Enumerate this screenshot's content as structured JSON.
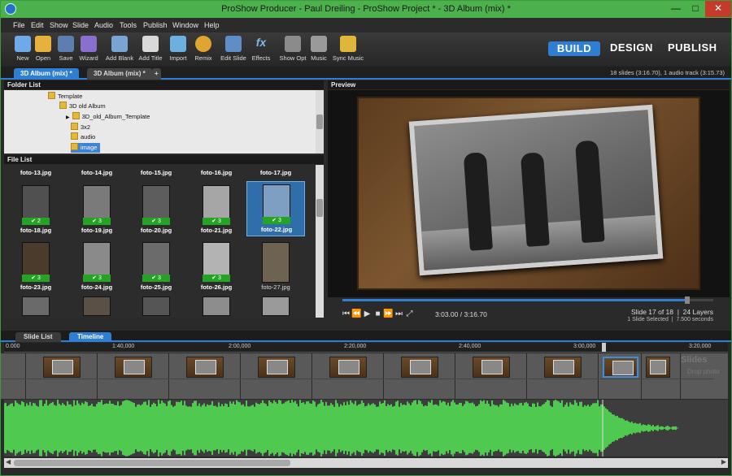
{
  "app": {
    "title": "ProShow Producer - Paul Dreiling - ProShow Project * - 3D Album (mix) *"
  },
  "menu": [
    "File",
    "Edit",
    "Show",
    "Slide",
    "Audio",
    "Tools",
    "Publish",
    "Window",
    "Help"
  ],
  "toolbar": {
    "buttons": [
      "New",
      "Open",
      "Save",
      "Wizard",
      "Add Blank",
      "Add Title",
      "Import",
      "Remix",
      "Edit Slide",
      "Effects",
      "Show Opt",
      "Music",
      "Sync Music"
    ]
  },
  "modes": {
    "build": "BUILD",
    "design": "DESIGN",
    "publish": "PUBLISH"
  },
  "project_tabs": {
    "active": "3D Album (mix) *",
    "other": "3D Album (mix) *",
    "add": "+"
  },
  "project_info": "18 slides (3:16.70), 1 audio track (3:15.73)",
  "folder_list": {
    "header": "Folder List",
    "items": [
      "Template",
      "3D old Album",
      "3D_old_Album_Template",
      "3x2",
      "audio",
      "image"
    ]
  },
  "file_list": {
    "header": "File List",
    "top_captions": [
      "foto-13.jpg",
      "foto-14.jpg",
      "foto-15.jpg",
      "foto-16.jpg",
      "foto-17.jpg"
    ],
    "rows": [
      [
        {
          "name": "foto-18.jpg",
          "count": "2"
        },
        {
          "name": "foto-19.jpg",
          "count": "3"
        },
        {
          "name": "foto-20.jpg",
          "count": "3"
        },
        {
          "name": "foto-21.jpg",
          "count": "3"
        },
        {
          "name": "foto-22.jpg",
          "count": "3"
        }
      ],
      [
        {
          "name": "foto-23.jpg",
          "count": "3"
        },
        {
          "name": "foto-24.jpg",
          "count": "3"
        },
        {
          "name": "foto-25.jpg",
          "count": "3"
        },
        {
          "name": "foto-26.jpg",
          "count": "3"
        },
        {
          "name": "foto-27.jpg",
          "count": ""
        }
      ]
    ]
  },
  "preview": {
    "header": "Preview",
    "timecode": "3:03.00 / 3:16.70",
    "slide_info": "Slide 17 of 18",
    "layers": "24 Layers",
    "selection_info": "1 Slide Selected",
    "seconds": "7.500 seconds",
    "position": 0.93
  },
  "bottom_tabs": {
    "slide_list": "Slide List",
    "timeline": "Timeline"
  },
  "timeline": {
    "ruler": [
      "0.000",
      "1:40,000",
      "2:00,000",
      "2:20,000",
      "2:40,000",
      "3:00,000",
      "3:20,000"
    ],
    "drop_title": "Slides",
    "drop_hint": "Drop photo"
  },
  "colors": {
    "accent": "#2e7fd3",
    "title_bar": "#4cb04c",
    "audio_wave": "#4fc94f",
    "check_badge": "#24a324"
  }
}
